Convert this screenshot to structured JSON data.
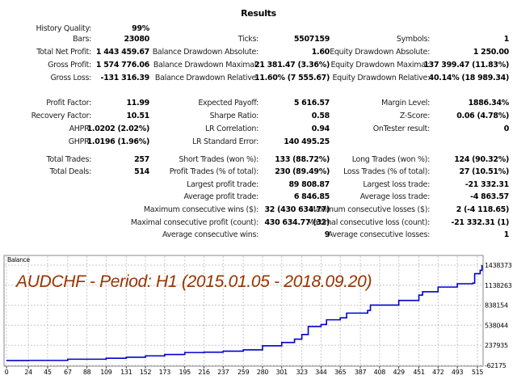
{
  "title": "Results",
  "stats": [
    [
      [
        "History Quality:",
        "99%"
      ],
      null,
      null
    ],
    [
      [
        "Bars:",
        "23080"
      ],
      [
        "Ticks:",
        "5507159"
      ],
      [
        "Symbols:",
        "1"
      ]
    ],
    [
      [
        "Total Net Profit:",
        "1 443 459.67"
      ],
      [
        "Balance Drawdown Absolute:",
        "1.60"
      ],
      [
        "Equity Drawdown Absolute:",
        "1 250.00"
      ]
    ],
    [
      [
        "Gross Profit:",
        "1 574 776.06"
      ],
      [
        "Balance Drawdown Maximal:",
        "21 381.47 (3.36%)"
      ],
      [
        "Equity Drawdown Maximal:",
        "137 399.47 (11.83%)"
      ]
    ],
    [
      [
        "Gross Loss:",
        "-131 316.39"
      ],
      [
        "Balance Drawdown Relative:",
        "11.60% (7 555.67)"
      ],
      [
        "Equity Drawdown Relative:",
        "40.14% (18 989.34)"
      ]
    ],
    [
      [
        "Profit Factor:",
        "11.99"
      ],
      [
        "Expected Payoff:",
        "5 616.57"
      ],
      [
        "Margin Level:",
        "1886.34%"
      ]
    ],
    [
      [
        "Recovery Factor:",
        "10.51"
      ],
      [
        "Sharpe Ratio:",
        "0.58"
      ],
      [
        "Z-Score:",
        "0.06 (4.78%)"
      ]
    ],
    [
      [
        "AHPR:",
        "1.0202 (2.02%)"
      ],
      [
        "LR Correlation:",
        "0.94"
      ],
      [
        "OnTester result:",
        "0"
      ]
    ],
    [
      [
        "GHPR:",
        "1.0196 (1.96%)"
      ],
      [
        "LR Standard Error:",
        "140 495.25"
      ],
      null
    ],
    [
      [
        "Total Trades:",
        "257"
      ],
      [
        "Short Trades (won %):",
        "133 (88.72%)"
      ],
      [
        "Long Trades (won %):",
        "124 (90.32%)"
      ]
    ],
    [
      [
        "Total Deals:",
        "514"
      ],
      [
        "Profit Trades (% of total):",
        "230 (89.49%)"
      ],
      [
        "Loss Trades (% of total):",
        "27 (10.51%)"
      ]
    ],
    [
      null,
      [
        "Largest profit trade:",
        "89 808.87"
      ],
      [
        "Largest loss trade:",
        "-21 332.31"
      ]
    ],
    [
      null,
      [
        "Average profit trade:",
        "6 846.85"
      ],
      [
        "Average loss trade:",
        "-4 863.57"
      ]
    ],
    [
      null,
      [
        "Maximum consecutive wins ($):",
        "32 (430 634.77)"
      ],
      [
        "Maximum consecutive losses ($):",
        "2 (-4 118.65)"
      ]
    ],
    [
      null,
      [
        "Maximal consecutive profit (count):",
        "430 634.77 (32)"
      ],
      [
        "Maximal consecutive loss (count):",
        "-21 332.31 (1)"
      ]
    ],
    [
      null,
      [
        "Average consecutive wins:",
        "9"
      ],
      [
        "Average consecutive losses:",
        "1"
      ]
    ]
  ],
  "chart_data": {
    "type": "line",
    "legend": "Balance",
    "title": "AUDCHF - Period: H1 (2015.01.05 - 2018.09.20)",
    "xlim": [
      0,
      520
    ],
    "ylim": [
      -62175,
      1438373
    ],
    "xticks": [
      "0",
      "24",
      "45",
      "67",
      "88",
      "109",
      "131",
      "152",
      "173",
      "195",
      "216",
      "237",
      "259",
      "280",
      "301",
      "323",
      "344",
      "365",
      "387",
      "408",
      "429",
      "451",
      "472",
      "493",
      "515"
    ],
    "yticks": [
      "1438373",
      "1138263",
      "838154",
      "538044",
      "237935",
      "-62175"
    ],
    "series": [
      {
        "name": "Balance",
        "color": "#0000cc",
        "x": [
          0,
          24,
          67,
          109,
          131,
          152,
          173,
          195,
          216,
          237,
          259,
          280,
          301,
          315,
          323,
          330,
          344,
          350,
          365,
          372,
          395,
          398,
          429,
          451,
          455,
          472,
          493,
          510,
          512,
          518,
          520
        ],
        "y": [
          10000,
          12000,
          30000,
          45000,
          60000,
          80000,
          100000,
          130000,
          135000,
          150000,
          170000,
          230000,
          280000,
          330000,
          400000,
          520000,
          550000,
          620000,
          650000,
          720000,
          760000,
          840000,
          910000,
          990000,
          1040000,
          1110000,
          1160000,
          1170000,
          1310000,
          1360000,
          1440000
        ]
      }
    ]
  },
  "colors": {
    "title": "#993300",
    "line": "#0000cc",
    "grid": "#c8c8c8"
  }
}
